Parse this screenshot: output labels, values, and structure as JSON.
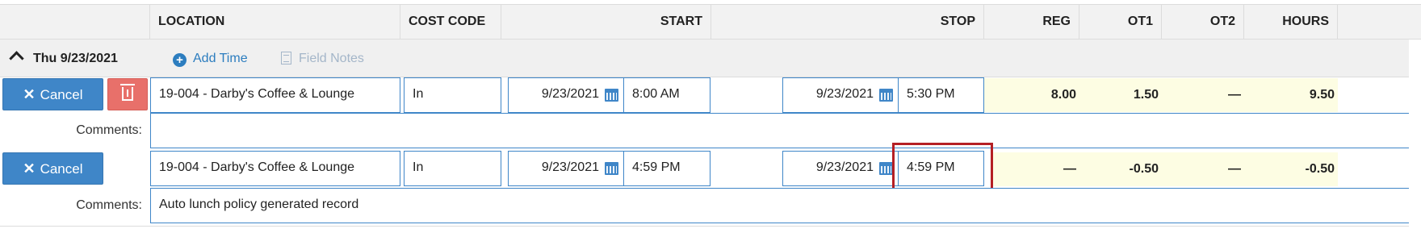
{
  "columns": {
    "location": "LOCATION",
    "cost_code": "COST CODE",
    "start": "START",
    "stop": "STOP",
    "reg": "REG",
    "ot1": "OT1",
    "ot2": "OT2",
    "hours": "HOURS"
  },
  "day": {
    "label": "Thu 9/23/2021",
    "add_time": "Add Time",
    "field_notes": "Field Notes"
  },
  "entries": [
    {
      "cancel_label": "Cancel",
      "location": "19-004 - Darby's Coffee & Lounge",
      "cost_code": "In",
      "start_date": "9/23/2021",
      "start_time": "8:00 AM",
      "stop_date": "9/23/2021",
      "stop_time": "5:30 PM",
      "reg": "8.00",
      "ot1": "1.50",
      "ot2": "—",
      "hours": "9.50",
      "comments_label": "Comments:",
      "comments": ""
    },
    {
      "cancel_label": "Cancel",
      "location": "19-004 - Darby's Coffee & Lounge",
      "cost_code": "In",
      "start_date": "9/23/2021",
      "start_time": "4:59 PM",
      "stop_date": "9/23/2021",
      "stop_time": "4:59 PM",
      "reg": "—",
      "ot1": "-0.50",
      "ot2": "—",
      "hours": "-0.50",
      "comments_label": "Comments:",
      "comments": "Auto lunch policy generated record"
    }
  ],
  "colors": {
    "accent": "#3f86c8",
    "delete": "#e8706a",
    "hours_bg": "#fdfde3",
    "highlight": "#b51f24",
    "link": "#2c7dbf",
    "disabled_link": "#a4b6c9"
  },
  "icons": [
    "chevron-up-icon",
    "plus-circle-icon",
    "notes-icon",
    "close-icon",
    "trash-icon",
    "calendar-icon"
  ]
}
